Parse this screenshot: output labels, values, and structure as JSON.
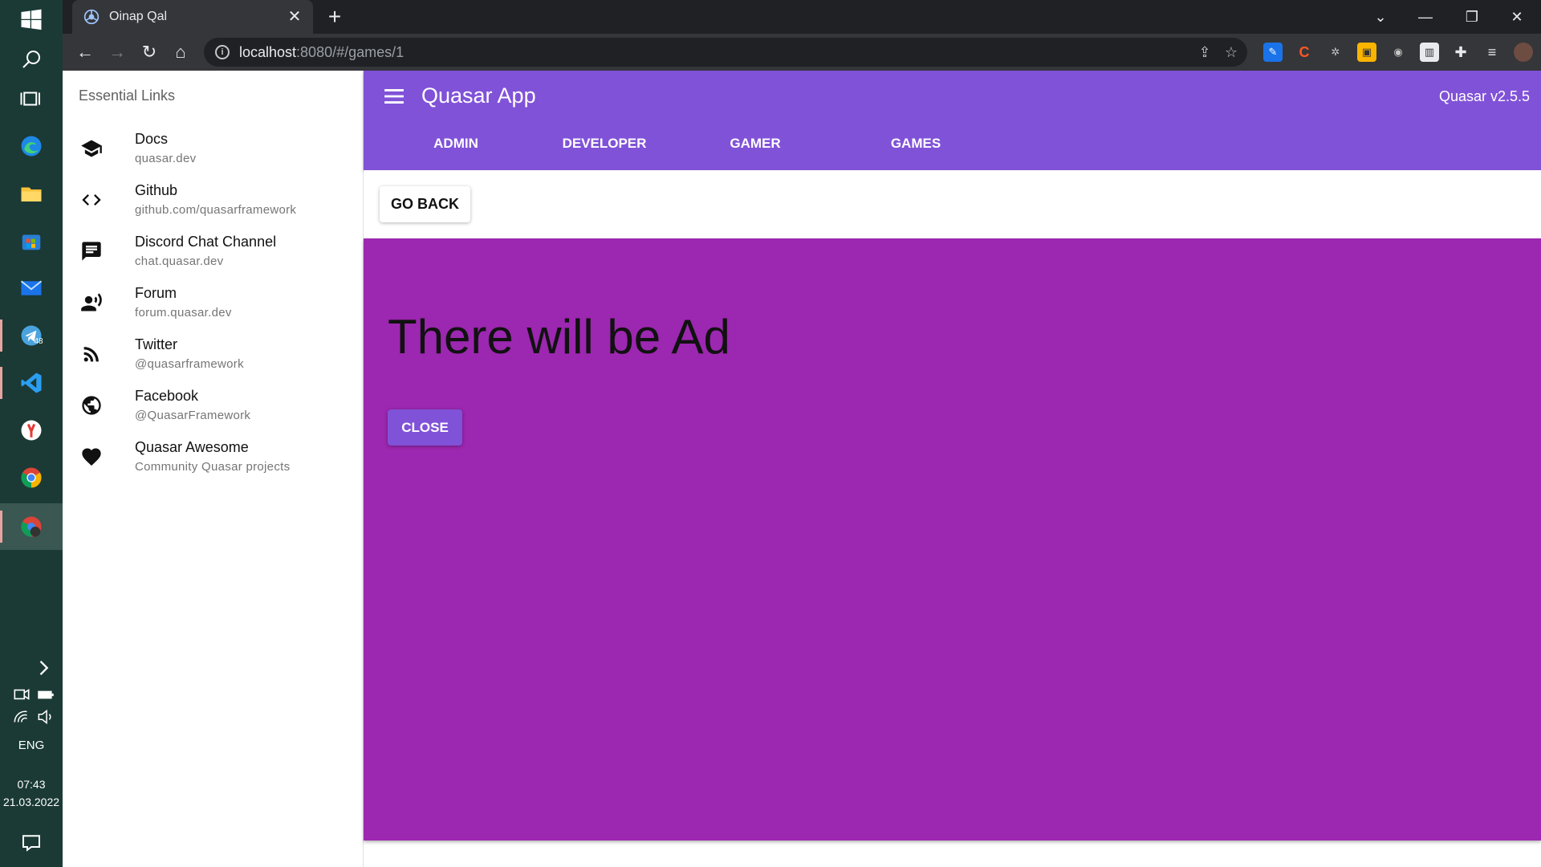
{
  "taskbar": {
    "lang": "ENG",
    "time": "07:43",
    "date": "21.03.2022",
    "telegram_badge": "48",
    "icons": [
      "windows-icon",
      "search-icon",
      "task-view-icon",
      "edge-icon",
      "file-explorer-icon",
      "store-icon",
      "mail-icon",
      "telegram-icon",
      "vscode-icon",
      "yandex-icon",
      "chrome-icon",
      "chrome-profile-icon"
    ]
  },
  "browser": {
    "tab_title": "Oinap Qal",
    "url_host": "localhost",
    "url_rest": ":8080/#/games/1"
  },
  "drawer": {
    "header": "Essential Links",
    "links": [
      {
        "title": "Docs",
        "caption": "quasar.dev",
        "icon": "school-icon"
      },
      {
        "title": "Github",
        "caption": "github.com/quasarframework",
        "icon": "code-icon"
      },
      {
        "title": "Discord Chat Channel",
        "caption": "chat.quasar.dev",
        "icon": "chat-icon"
      },
      {
        "title": "Forum",
        "caption": "forum.quasar.dev",
        "icon": "record-voice-icon"
      },
      {
        "title": "Twitter",
        "caption": "@quasarframework",
        "icon": "rss-feed-icon"
      },
      {
        "title": "Facebook",
        "caption": "@QuasarFramework",
        "icon": "public-icon"
      },
      {
        "title": "Quasar Awesome",
        "caption": "Community Quasar projects",
        "icon": "favorite-icon"
      }
    ]
  },
  "header": {
    "title": "Quasar App",
    "version": "Quasar v2.5.5",
    "tabs": [
      {
        "label": "Admin"
      },
      {
        "label": "Developer"
      },
      {
        "label": "Gamer"
      },
      {
        "label": "Games"
      }
    ]
  },
  "main": {
    "go_back_label": "Go back",
    "ad_text": "There will be Ad",
    "close_label": "Close"
  },
  "colors": {
    "primary": "#8052d8",
    "ad_background": "#9c27b0",
    "taskbar": "#1b3a35"
  }
}
